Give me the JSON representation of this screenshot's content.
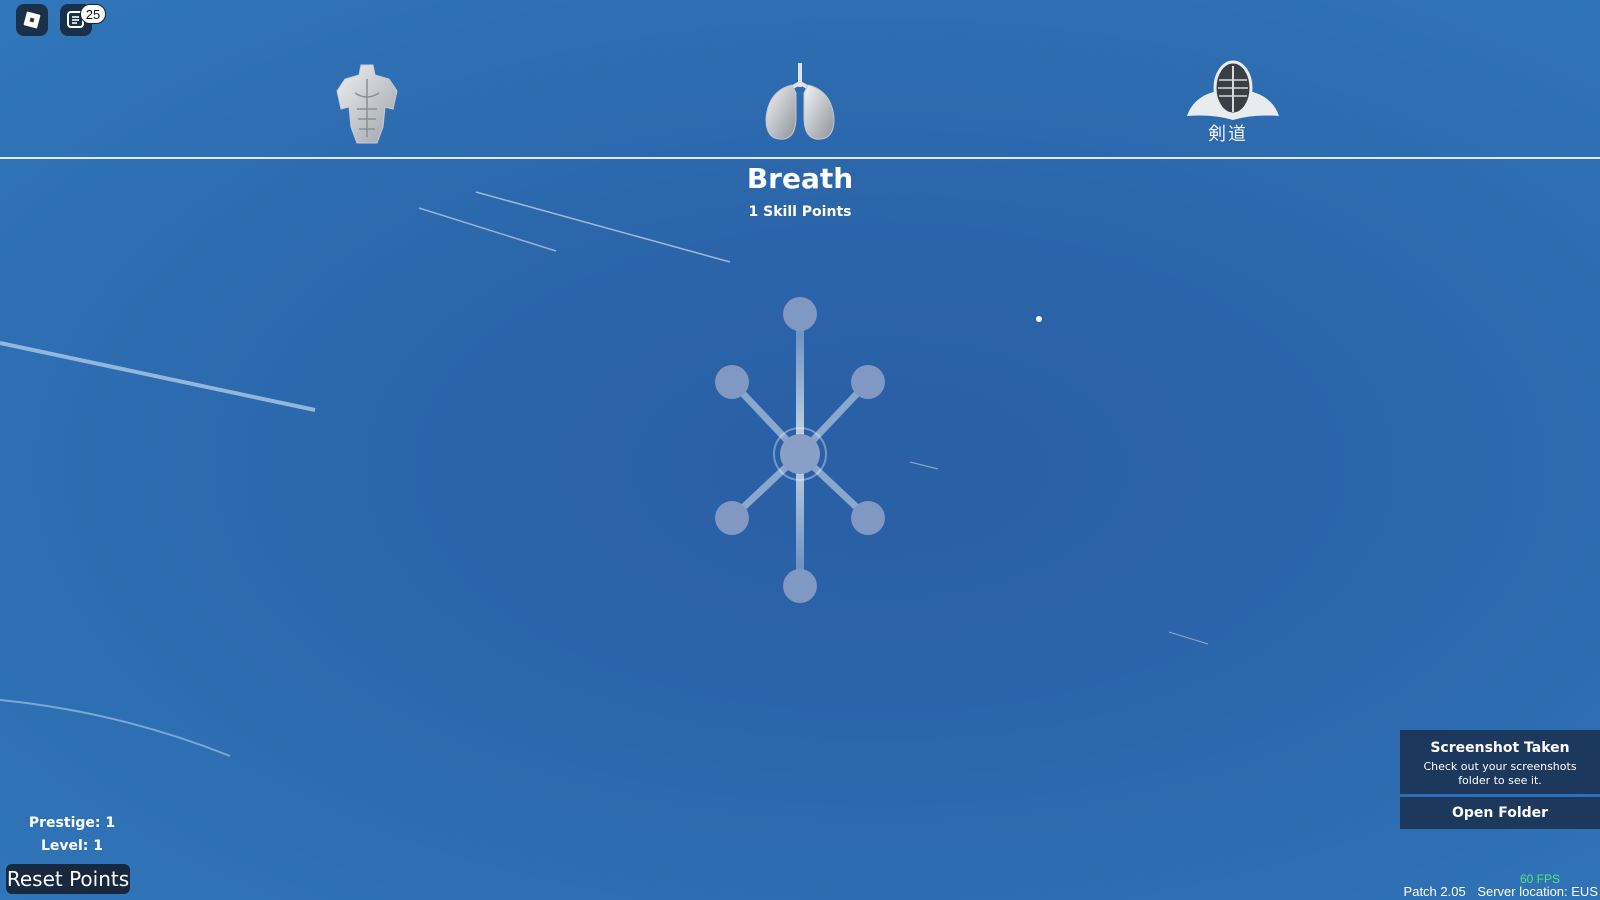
{
  "topbar": {
    "roblox_menu_icon": "roblox-logo-icon",
    "chat_icon": "chat-icon",
    "chat_badge": "25"
  },
  "categories": [
    {
      "name": "body-torso-icon"
    },
    {
      "name": "lungs-icon"
    },
    {
      "name": "kendo-helmet-icon",
      "caption": "剣道"
    }
  ],
  "panel": {
    "title": "Breath",
    "skill_points": "1 Skill Points"
  },
  "skill_tree": {
    "node_count": 7,
    "nodes": [
      "top",
      "upper-left",
      "upper-right",
      "center",
      "lower-left",
      "lower-right",
      "bottom"
    ]
  },
  "player": {
    "prestige": "Prestige: 1",
    "level": "Level: 1",
    "reset_label": "Reset Points"
  },
  "toast": {
    "title": "Screenshot Taken",
    "message": "Check out your screenshots folder to see it.",
    "button": "Open Folder"
  },
  "status": {
    "fps": "60 FPS",
    "patch": "Patch 2.05",
    "server": "Server location: EUS"
  },
  "colors": {
    "background": "#2b64a9",
    "node": "#8098c2",
    "fps": "#5fe07a"
  }
}
